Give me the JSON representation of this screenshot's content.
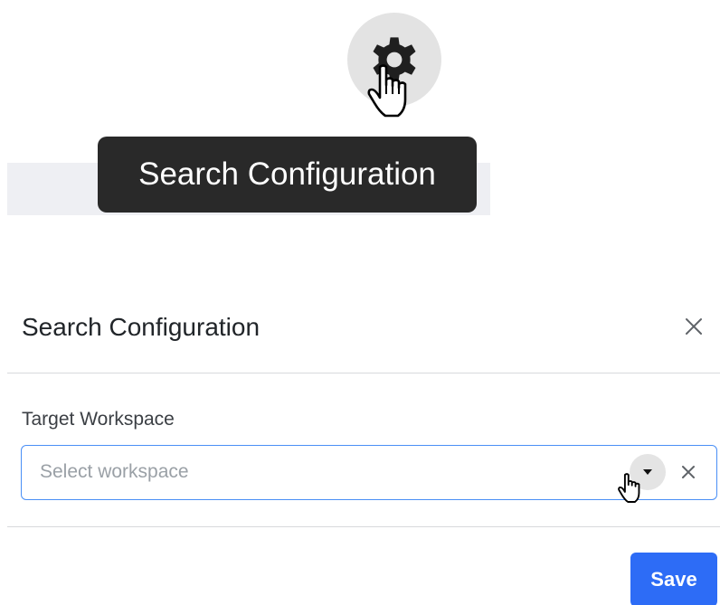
{
  "tooltip": {
    "text": "Search Configuration"
  },
  "icons": {
    "settings": "gear-icon",
    "pointer": "hand-pointer-cursor",
    "close": "close-icon",
    "dropdown": "caret-down-icon",
    "clear": "clear-icon"
  },
  "modal": {
    "title": "Search Configuration",
    "field_label": "Target Workspace",
    "select": {
      "placeholder": "Select workspace",
      "value": ""
    },
    "save_label": "Save"
  },
  "colors": {
    "tooltip_bg": "#292929",
    "accent": "#2d6cf6",
    "focus_border": "#4a8ff6",
    "hover_circle": "#e3e3e3",
    "strip_bg": "#eeeff3"
  }
}
